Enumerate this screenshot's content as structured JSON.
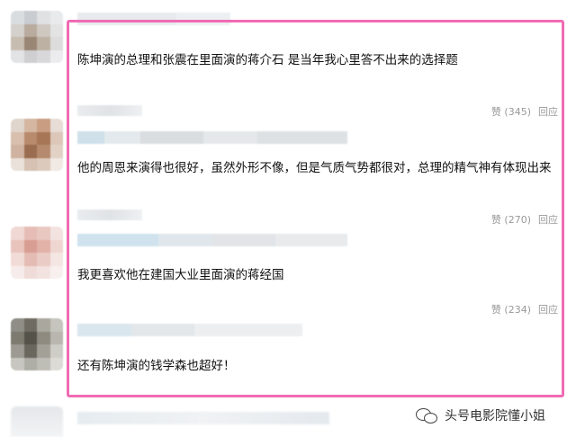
{
  "comments": [
    {
      "text": "陈坤演的总理和张震在里面演的蒋介石 是当年我心里答不出来的选择题",
      "like_count": "(345)",
      "like_label": "赞",
      "reply_label": "回应",
      "avatar_colors": [
        "#dadde0",
        "#c9ccd0",
        "#dfe1e3",
        "#e8eaec",
        "#d4d0cb",
        "#b9ab9e",
        "#cfc8c0",
        "#e3e3e3",
        "#c8bdb1",
        "#9a8674",
        "#bdb1a4",
        "#dcdcdc",
        "#e2e3e5",
        "#cfcfd1",
        "#d8d8da",
        "#ececee"
      ]
    },
    {
      "text": "他的周恩来演得也很好，虽然外形不像，但是气质气势都很对，总理的精气神有体现出来",
      "like_count": "(270)",
      "like_label": "赞",
      "reply_label": "回应",
      "avatar_colors": [
        "#e0d5cc",
        "#d4b6a1",
        "#c99d82",
        "#e7ddd6",
        "#d8bfae",
        "#b88b6c",
        "#a67656",
        "#dcc7b8",
        "#cfb3a0",
        "#9b6d50",
        "#b58a6e",
        "#e2d2c6",
        "#e9e1da",
        "#d6c1b2",
        "#dccabd",
        "#f0e9e4"
      ]
    },
    {
      "text": "我更喜欢他在建国大业里面演的蒋经国",
      "like_count": "(234)",
      "like_label": "赞",
      "reply_label": "回应",
      "avatar_colors": [
        "#f0d8d4",
        "#e6bdb6",
        "#e8c8c1",
        "#f3e3e0",
        "#e9c4bd",
        "#d99e93",
        "#e2b1a8",
        "#efd6d1",
        "#f2dcd8",
        "#e4bcb4",
        "#eacbc5",
        "#f4e6e3",
        "#f6eceb",
        "#efdcd8",
        "#f2e3e0",
        "#f8f0ef"
      ]
    },
    {
      "text": "还有陈坤演的钱学森也超好！",
      "avatar_colors": [
        "#8f8e86",
        "#6f6b62",
        "#a9a79e",
        "#c5c4bd",
        "#7d7a70",
        "#55524a",
        "#8e8a80",
        "#b8b6ae",
        "#9c9a92",
        "#6a675f",
        "#a3a098",
        "#cfcdc7",
        "#c7c6c0",
        "#aeada6",
        "#bebdb6",
        "#dcdbd6"
      ]
    }
  ],
  "watermark": {
    "text": "头号电影院懂小姐",
    "icon": "wechat-icon"
  },
  "colors": {
    "highlight_border": "#f06bb3",
    "action_text": "#999999"
  }
}
